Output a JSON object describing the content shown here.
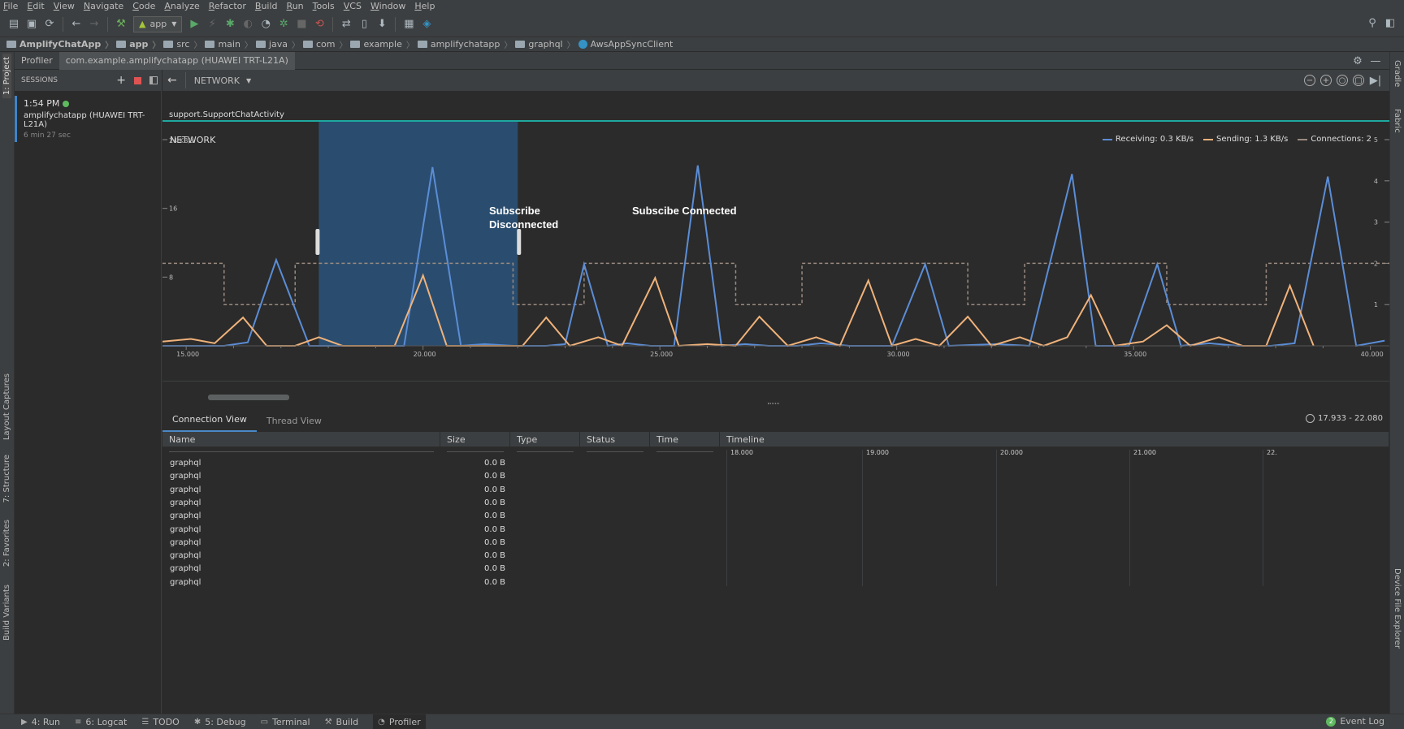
{
  "menu": [
    "File",
    "Edit",
    "View",
    "Navigate",
    "Code",
    "Analyze",
    "Refactor",
    "Build",
    "Run",
    "Tools",
    "VCS",
    "Window",
    "Help"
  ],
  "toolbar": {
    "run_config": "app"
  },
  "breadcrumbs": [
    {
      "label": "AmplifyChatApp",
      "kind": "folder",
      "bold": true
    },
    {
      "label": "app",
      "kind": "folder",
      "bold": true
    },
    {
      "label": "src",
      "kind": "folder"
    },
    {
      "label": "main",
      "kind": "folder"
    },
    {
      "label": "java",
      "kind": "folder"
    },
    {
      "label": "com",
      "kind": "folder"
    },
    {
      "label": "example",
      "kind": "folder"
    },
    {
      "label": "amplifychatapp",
      "kind": "folder"
    },
    {
      "label": "graphql",
      "kind": "folder"
    },
    {
      "label": "AwsAppSyncClient",
      "kind": "class"
    }
  ],
  "left_tabs": [
    "1: Project",
    "Layout Captures",
    "7: Structure",
    "2: Favorites",
    "Build Variants"
  ],
  "right_tabs": [
    "Gradle",
    "Fabric",
    "Device File Explorer"
  ],
  "profiler": {
    "title": "Profiler",
    "session_tab": "com.example.amplifychatapp (HUAWEI TRT-L21A)"
  },
  "sessions": {
    "header": "SESSIONS",
    "item": {
      "time": "1:54 PM",
      "device": "amplifychatapp (HUAWEI TRT-L21A)",
      "duration": "6 min 27 sec"
    }
  },
  "monitor": {
    "selector": "NETWORK"
  },
  "activity": {
    "label": "support.SupportChatActivity"
  },
  "annotations": {
    "disconnected": [
      "Subscribe",
      "Disconnected"
    ],
    "connected": "Subscibe Connected"
  },
  "chart_data": {
    "type": "line",
    "title": "NETWORK",
    "y_left_label": "24 KB/s",
    "y_left_ticks": [
      "16",
      "8"
    ],
    "y_right_ticks": [
      "5",
      "4",
      "3",
      "2",
      "1"
    ],
    "x_ticks": [
      "15.000",
      "20.000",
      "25.000",
      "30.000",
      "35.000",
      "40.000"
    ],
    "x_range": [
      14.5,
      40.4
    ],
    "y_left_range": [
      0,
      24
    ],
    "y_right_range": [
      0,
      5
    ],
    "selection_range": [
      17.8,
      22.0
    ],
    "legend": [
      {
        "label": "Receiving: 0.3 KB/s",
        "color": "#5b8dd6",
        "style": "solid"
      },
      {
        "label": "Sending: 1.3 KB/s",
        "color": "#f0b27a",
        "style": "solid"
      },
      {
        "label": "Connections: 2",
        "color": "#9a8a80",
        "style": "dashed"
      }
    ],
    "series": [
      {
        "name": "Receiving",
        "color": "#5b8dd6",
        "points": [
          [
            14.5,
            0
          ],
          [
            15.8,
            0
          ],
          [
            16.3,
            0.4
          ],
          [
            16.9,
            10
          ],
          [
            17.6,
            0
          ],
          [
            18.5,
            0
          ],
          [
            19.0,
            0
          ],
          [
            19.6,
            0
          ],
          [
            20.2,
            20.8
          ],
          [
            20.8,
            0
          ],
          [
            21.3,
            0.2
          ],
          [
            21.9,
            0
          ],
          [
            22.6,
            0
          ],
          [
            23.0,
            0.2
          ],
          [
            23.4,
            9.5
          ],
          [
            23.9,
            0
          ],
          [
            24.3,
            0.3
          ],
          [
            24.8,
            0
          ],
          [
            25.3,
            0
          ],
          [
            25.8,
            21
          ],
          [
            26.3,
            0
          ],
          [
            26.8,
            0.2
          ],
          [
            27.3,
            0
          ],
          [
            27.9,
            0
          ],
          [
            28.4,
            0.3
          ],
          [
            29.0,
            0
          ],
          [
            29.9,
            0
          ],
          [
            30.6,
            9.5
          ],
          [
            31.1,
            0
          ],
          [
            32.1,
            0.2
          ],
          [
            32.8,
            0
          ],
          [
            33.7,
            20
          ],
          [
            34.2,
            0
          ],
          [
            34.9,
            0
          ],
          [
            35.5,
            9.5
          ],
          [
            36.0,
            0
          ],
          [
            36.6,
            0.3
          ],
          [
            37.2,
            0
          ],
          [
            37.9,
            0
          ],
          [
            38.4,
            0.3
          ],
          [
            39.1,
            19.7
          ],
          [
            39.7,
            0
          ],
          [
            40.3,
            0.6
          ],
          [
            40.9,
            0
          ],
          [
            41.4,
            0.8
          ],
          [
            41.8,
            0
          ],
          [
            42.9,
            13.3
          ],
          [
            43.4,
            0
          ],
          [
            44.0,
            0.2
          ],
          [
            44.5,
            0
          ],
          [
            45.0,
            15.4
          ],
          [
            45.5,
            0
          ],
          [
            45.9,
            0.8
          ],
          [
            46.4,
            0
          ]
        ]
      },
      {
        "name": "Sending",
        "color": "#f0b27a",
        "points": [
          [
            14.5,
            0.5
          ],
          [
            15.1,
            0.8
          ],
          [
            15.6,
            0.3
          ],
          [
            16.2,
            3.3
          ],
          [
            16.7,
            0
          ],
          [
            17.3,
            0
          ],
          [
            17.8,
            1.0
          ],
          [
            18.3,
            0
          ],
          [
            18.9,
            0
          ],
          [
            19.4,
            0
          ],
          [
            20.0,
            8.2
          ],
          [
            20.5,
            0
          ],
          [
            21.0,
            0
          ],
          [
            21.6,
            0
          ],
          [
            22.1,
            0
          ],
          [
            22.6,
            3.3
          ],
          [
            23.1,
            0
          ],
          [
            23.7,
            1.0
          ],
          [
            24.2,
            0
          ],
          [
            24.9,
            7.9
          ],
          [
            25.4,
            0
          ],
          [
            26.0,
            0.2
          ],
          [
            26.6,
            0
          ],
          [
            27.1,
            3.4
          ],
          [
            27.7,
            0
          ],
          [
            28.3,
            1.0
          ],
          [
            28.8,
            0
          ],
          [
            29.4,
            7.6
          ],
          [
            29.9,
            0
          ],
          [
            30.4,
            0.8
          ],
          [
            30.9,
            0
          ],
          [
            31.5,
            3.4
          ],
          [
            32.0,
            0
          ],
          [
            32.6,
            1.0
          ],
          [
            33.1,
            0
          ],
          [
            33.6,
            1.0
          ],
          [
            34.1,
            5.9
          ],
          [
            34.6,
            0
          ],
          [
            35.2,
            0.5
          ],
          [
            35.7,
            2.4
          ],
          [
            36.2,
            0
          ],
          [
            36.8,
            1.0
          ],
          [
            37.3,
            0
          ],
          [
            37.8,
            0
          ],
          [
            38.3,
            7.0
          ],
          [
            38.8,
            0
          ]
        ]
      },
      {
        "name": "Connections",
        "color": "#9a8a80",
        "axis": "right",
        "steps": [
          [
            14.5,
            2
          ],
          [
            15.8,
            1
          ],
          [
            17.3,
            2
          ],
          [
            21.9,
            1
          ],
          [
            23.4,
            2
          ],
          [
            26.6,
            1
          ],
          [
            28.0,
            2
          ],
          [
            31.5,
            1
          ],
          [
            32.7,
            2
          ],
          [
            35.7,
            1
          ],
          [
            37.8,
            2
          ],
          [
            40.5,
            2
          ]
        ]
      }
    ]
  },
  "connections": {
    "tabs": [
      "Connection View",
      "Thread View"
    ],
    "range": "17.933 - 22.080",
    "columns": [
      "Name",
      "Size",
      "Type",
      "Status",
      "Time",
      "Timeline"
    ],
    "timeline_ticks": [
      "18.000",
      "19.000",
      "20.000",
      "21.000",
      "22."
    ],
    "rows": [
      {
        "name": "graphql",
        "size": "0.0 B"
      },
      {
        "name": "graphql",
        "size": "0.0 B"
      },
      {
        "name": "graphql",
        "size": "0.0 B"
      },
      {
        "name": "graphql",
        "size": "0.0 B"
      },
      {
        "name": "graphql",
        "size": "0.0 B"
      },
      {
        "name": "graphql",
        "size": "0.0 B"
      },
      {
        "name": "graphql",
        "size": "0.0 B"
      },
      {
        "name": "graphql",
        "size": "0.0 B"
      },
      {
        "name": "graphql",
        "size": "0.0 B"
      },
      {
        "name": "graphql",
        "size": "0.0 B"
      }
    ]
  },
  "statusbar": {
    "items": [
      {
        "icon": "run-icon",
        "glyph": "▶",
        "label": "4: Run"
      },
      {
        "icon": "logcat-icon",
        "glyph": "≡",
        "label": "6: Logcat"
      },
      {
        "icon": "todo-icon",
        "glyph": "☰",
        "label": "TODO"
      },
      {
        "icon": "debug-icon",
        "glyph": "✱",
        "label": "5: Debug"
      },
      {
        "icon": "terminal-icon",
        "glyph": "▭",
        "label": "Terminal"
      },
      {
        "icon": "build-icon",
        "glyph": "⚒",
        "label": "Build"
      },
      {
        "icon": "profiler-icon",
        "glyph": "◔",
        "label": "Profiler",
        "active": true
      }
    ],
    "event_log": "Event Log",
    "event_count": "2"
  }
}
